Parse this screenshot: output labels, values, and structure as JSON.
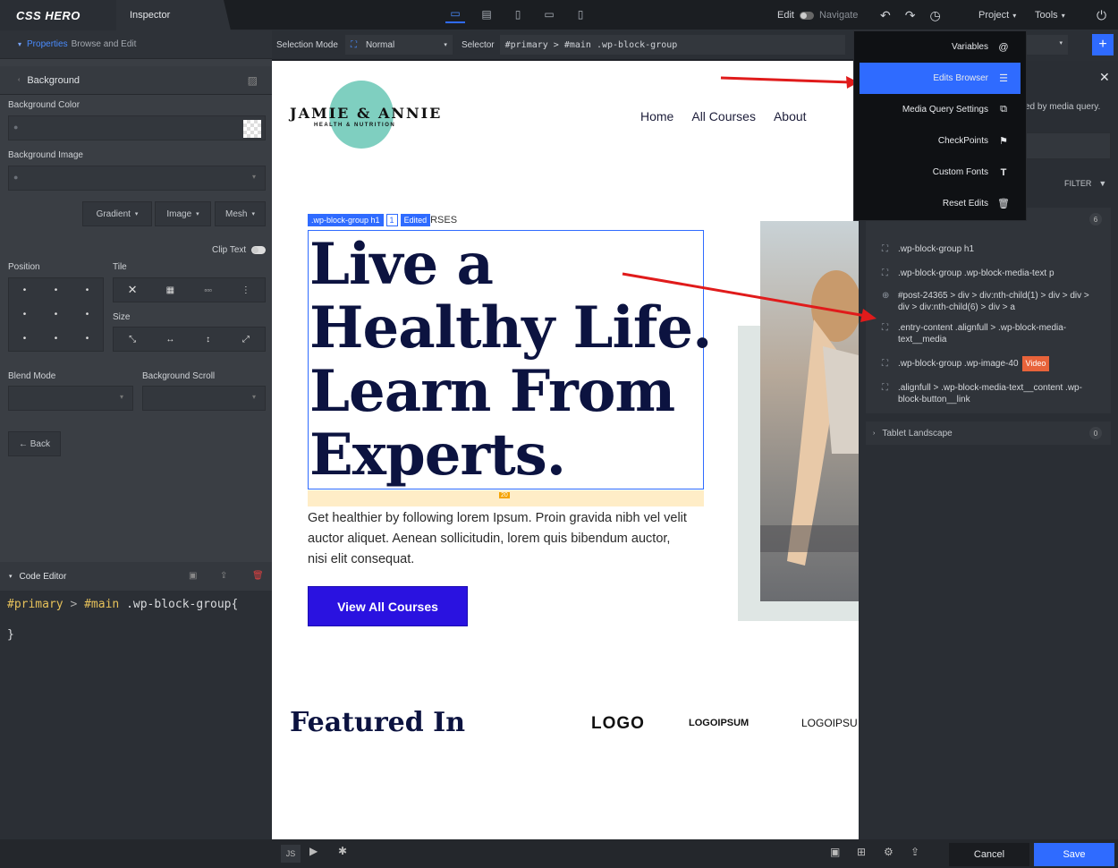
{
  "topbar": {
    "logo": "CSS HERO",
    "inspector_tab": "Inspector",
    "edit_label": "Edit",
    "navigate_label": "Navigate",
    "project_label": "Project",
    "tools_label": "Tools"
  },
  "left_panel": {
    "properties_link": "Properties",
    "properties_sub": "Browse and Edit",
    "section": "Background",
    "bg_color_label": "Background Color",
    "bg_image_label": "Background Image",
    "gradient_btn": "Gradient",
    "image_btn": "Image",
    "mesh_btn": "Mesh",
    "clip_text": "Clip Text",
    "position_label": "Position",
    "tile_label": "Tile",
    "size_label": "Size",
    "blend_label": "Blend Mode",
    "scroll_label": "Background Scroll",
    "back_btn": "← Back"
  },
  "code_editor": {
    "title": "Code Editor",
    "line1_a": "#primary",
    "line1_b": " > ",
    "line1_c": "#main",
    "line1_d": " .wp-block-group{",
    "line3": "}"
  },
  "selbar": {
    "mode_label": "Selection Mode",
    "mode_value": "Normal",
    "selector_label": "Selector",
    "selector_value": "#primary > #main .wp-block-group"
  },
  "canvas": {
    "brand_name": "JAMIE & ANNIE",
    "brand_sub": "HEALTH & NUTRITION",
    "nav": [
      "Home",
      "All Courses",
      "About"
    ],
    "selection_tag": ".wp-block-group h1",
    "selection_count": "1",
    "edited_badge": "Edited",
    "eyebrow_tail": "RSES",
    "heading_lines": [
      "Live a",
      "Healthy Life.",
      "Learn From",
      "Experts."
    ],
    "margin_badge": "20",
    "paragraph": "Get healthier by following lorem Ipsum. Proin gravida nibh vel velit auctor aliquet. Aenean sollicitudin, lorem quis bibendum auctor, nisi elit consequat.",
    "cta": "View All Courses",
    "featured": "Featured In",
    "logos": [
      "LOGO",
      "LOGOIPSUM",
      "LOGOIPSU"
    ]
  },
  "menu": {
    "items": [
      {
        "label": "Variables",
        "icon": "at-icon"
      },
      {
        "label": "Edits Browser",
        "icon": "list-icon"
      },
      {
        "label": "Media Query Settings",
        "icon": "devices-icon"
      },
      {
        "label": "CheckPoints",
        "icon": "flag-icon"
      },
      {
        "label": "Custom Fonts",
        "icon": "font-icon"
      },
      {
        "label": "Reset Edits",
        "icon": "trash-icon"
      }
    ]
  },
  "right_panel": {
    "hint": "ed by media query.",
    "filter": "FILTER",
    "count_top": "6",
    "edits": [
      ".wp-block-group h1",
      ".wp-block-group .wp-block-media-text p",
      "#post-24365 > div > div:nth-child(1) > div > div > div > div:nth-child(6) > div > a",
      ".entry-content .alignfull > .wp-block-media-text__media",
      ".wp-block-group .wp-image-40",
      ".alignfull > .wp-block-media-text__content .wp-block-button__link"
    ],
    "video_badge": "Video",
    "tablet_label": "Tablet Landscape",
    "tablet_count": "0"
  },
  "bottom": {
    "js": "JS",
    "cancel": "Cancel",
    "save": "Save"
  },
  "colors": {
    "accent": "#2f6bff",
    "heading": "#0c1340",
    "cta": "#2a12e0",
    "arrow": "#e01b1b",
    "video_badge": "#e8633a"
  }
}
